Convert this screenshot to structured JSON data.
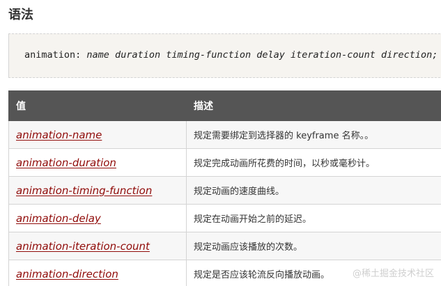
{
  "section": {
    "title": "语法"
  },
  "syntax": {
    "property": "animation:",
    "arguments": "name duration timing-function delay iteration-count direction;"
  },
  "table": {
    "headers": [
      "值",
      "描述"
    ],
    "rows": [
      {
        "value": "animation-name",
        "description": "规定需要绑定到选择器的 keyframe 名称。。"
      },
      {
        "value": "animation-duration",
        "description": "规定完成动画所花费的时间，以秒或毫秒计。"
      },
      {
        "value": "animation-timing-function",
        "description": "规定动画的速度曲线。"
      },
      {
        "value": "animation-delay",
        "description": "规定在动画开始之前的延迟。"
      },
      {
        "value": "animation-iteration-count",
        "description": "规定动画应该播放的次数。"
      },
      {
        "value": "animation-direction",
        "description": "规定是否应该轮流反向播放动画。"
      }
    ]
  },
  "watermark": {
    "text": "@稀土掘金技术社区"
  },
  "colors": {
    "header_bg": "#555555",
    "link": "#900b09",
    "code_bg": "#f6f4f0"
  }
}
